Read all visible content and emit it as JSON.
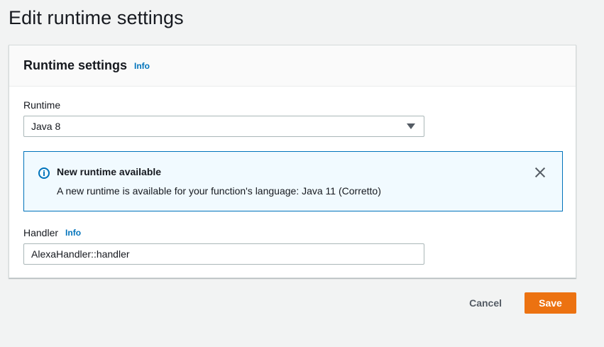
{
  "page": {
    "title": "Edit runtime settings"
  },
  "panel": {
    "title": "Runtime settings",
    "info_link": "Info"
  },
  "runtime": {
    "label": "Runtime",
    "selected": "Java 8"
  },
  "alert": {
    "icon": "info-circle-icon",
    "title": "New runtime available",
    "message": "A new runtime is available for your function's language: Java 11 (Corretto)"
  },
  "handler": {
    "label": "Handler",
    "info_link": "Info",
    "value": "AlexaHandler::handler"
  },
  "actions": {
    "cancel_label": "Cancel",
    "save_label": "Save"
  },
  "colors": {
    "accent": "#0073bb",
    "primary_button": "#ec7211",
    "alert_background": "#f1faff"
  }
}
